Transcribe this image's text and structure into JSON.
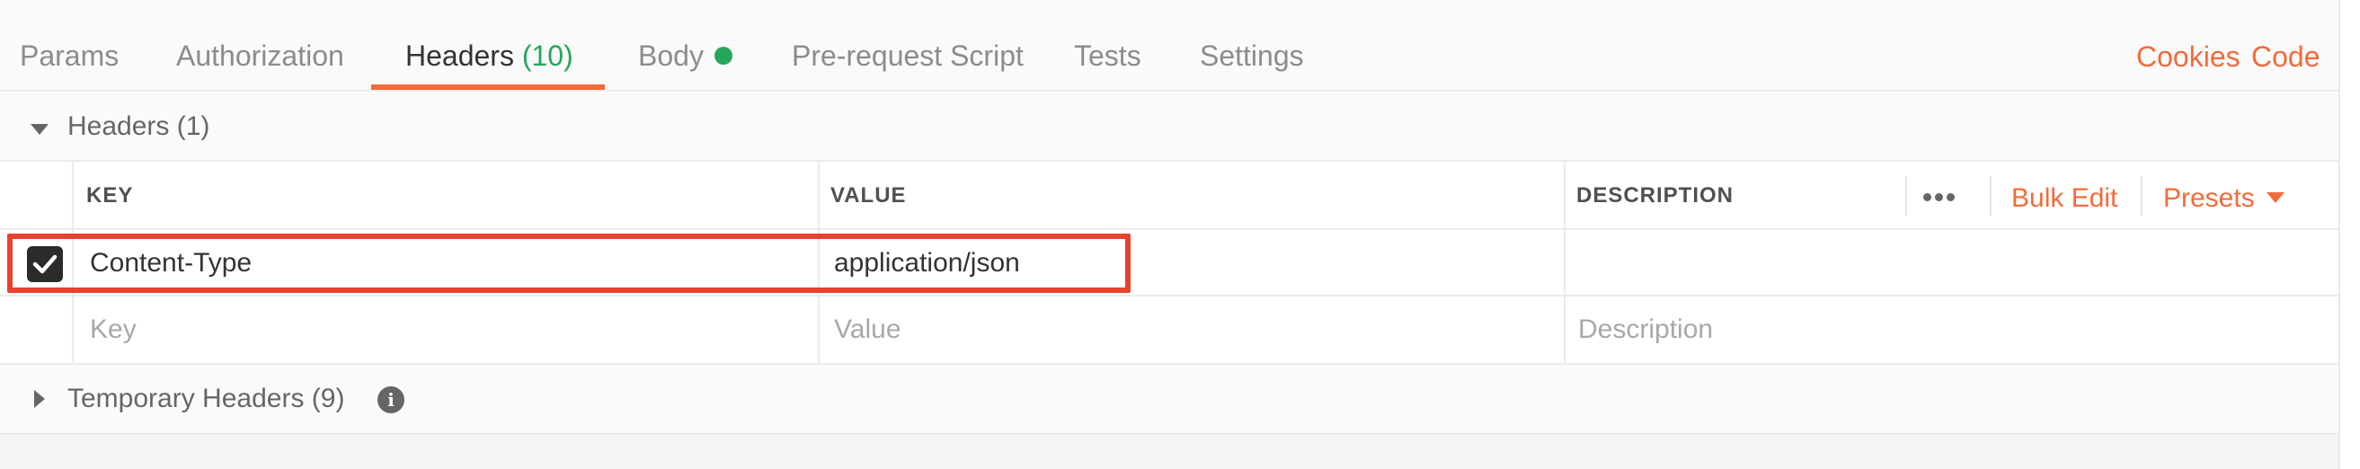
{
  "tabs": [
    {
      "label": "Params"
    },
    {
      "label": "Authorization"
    },
    {
      "label": "Headers",
      "count": "(10)"
    },
    {
      "label": "Body"
    },
    {
      "label": "Pre-request Script"
    },
    {
      "label": "Tests"
    },
    {
      "label": "Settings"
    }
  ],
  "active_tab": "Headers",
  "top_links": {
    "cookies": "Cookies",
    "code": "Code"
  },
  "headers_section": {
    "title": "Headers",
    "count": "(1)"
  },
  "columns": {
    "key": "KEY",
    "value": "VALUE",
    "description": "DESCRIPTION"
  },
  "table_actions": {
    "more_icon": "ellipsis-icon",
    "bulk_edit": "Bulk Edit",
    "presets": "Presets"
  },
  "rows": [
    {
      "checked": true,
      "key": "Content-Type",
      "value": "application/json",
      "description": ""
    }
  ],
  "placeholders": {
    "key": "Key",
    "value": "Value",
    "description": "Description"
  },
  "temp_section": {
    "title": "Temporary Headers",
    "count": "(9)",
    "icon": "info-icon"
  },
  "colors": {
    "accent": "#f26b3a",
    "success": "#26a65b",
    "highlight": "#e8412d"
  }
}
